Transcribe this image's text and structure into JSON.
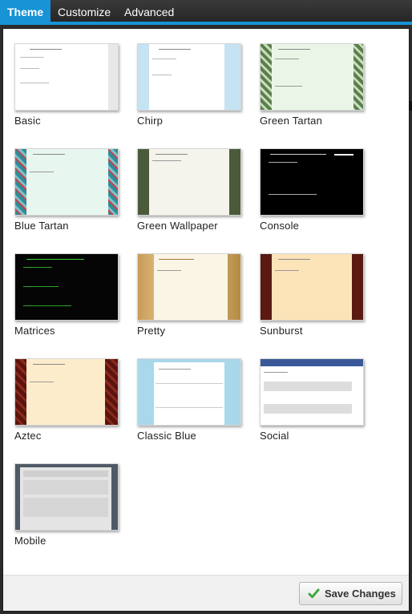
{
  "tabs": [
    {
      "label": "Theme",
      "active": true
    },
    {
      "label": "Customize",
      "active": false
    },
    {
      "label": "Advanced",
      "active": false
    }
  ],
  "themes": [
    {
      "name": "Basic"
    },
    {
      "name": "Chirp"
    },
    {
      "name": "Green Tartan"
    },
    {
      "name": "Blue Tartan"
    },
    {
      "name": "Green Wallpaper"
    },
    {
      "name": "Console"
    },
    {
      "name": "Matrices"
    },
    {
      "name": "Pretty"
    },
    {
      "name": "Sunburst"
    },
    {
      "name": "Aztec"
    },
    {
      "name": "Classic Blue"
    },
    {
      "name": "Social"
    },
    {
      "name": "Mobile"
    }
  ],
  "footer": {
    "save_label": "Save Changes"
  },
  "colors": {
    "accent": "#1793d6",
    "checkmark": "#3aa63a"
  }
}
